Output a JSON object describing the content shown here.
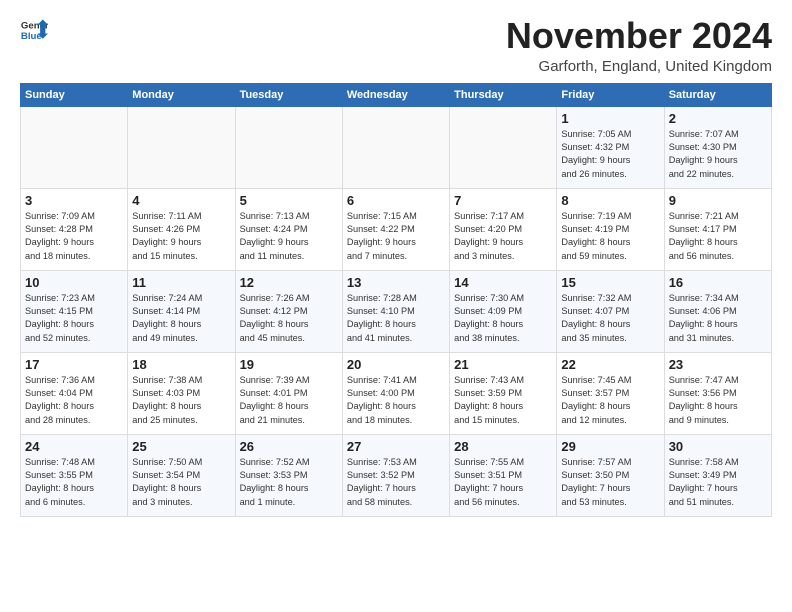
{
  "logo": {
    "general": "General",
    "blue": "Blue"
  },
  "title": "November 2024",
  "location": "Garforth, England, United Kingdom",
  "headers": [
    "Sunday",
    "Monday",
    "Tuesday",
    "Wednesday",
    "Thursday",
    "Friday",
    "Saturday"
  ],
  "weeks": [
    [
      {
        "day": "",
        "info": ""
      },
      {
        "day": "",
        "info": ""
      },
      {
        "day": "",
        "info": ""
      },
      {
        "day": "",
        "info": ""
      },
      {
        "day": "",
        "info": ""
      },
      {
        "day": "1",
        "info": "Sunrise: 7:05 AM\nSunset: 4:32 PM\nDaylight: 9 hours\nand 26 minutes."
      },
      {
        "day": "2",
        "info": "Sunrise: 7:07 AM\nSunset: 4:30 PM\nDaylight: 9 hours\nand 22 minutes."
      }
    ],
    [
      {
        "day": "3",
        "info": "Sunrise: 7:09 AM\nSunset: 4:28 PM\nDaylight: 9 hours\nand 18 minutes."
      },
      {
        "day": "4",
        "info": "Sunrise: 7:11 AM\nSunset: 4:26 PM\nDaylight: 9 hours\nand 15 minutes."
      },
      {
        "day": "5",
        "info": "Sunrise: 7:13 AM\nSunset: 4:24 PM\nDaylight: 9 hours\nand 11 minutes."
      },
      {
        "day": "6",
        "info": "Sunrise: 7:15 AM\nSunset: 4:22 PM\nDaylight: 9 hours\nand 7 minutes."
      },
      {
        "day": "7",
        "info": "Sunrise: 7:17 AM\nSunset: 4:20 PM\nDaylight: 9 hours\nand 3 minutes."
      },
      {
        "day": "8",
        "info": "Sunrise: 7:19 AM\nSunset: 4:19 PM\nDaylight: 8 hours\nand 59 minutes."
      },
      {
        "day": "9",
        "info": "Sunrise: 7:21 AM\nSunset: 4:17 PM\nDaylight: 8 hours\nand 56 minutes."
      }
    ],
    [
      {
        "day": "10",
        "info": "Sunrise: 7:23 AM\nSunset: 4:15 PM\nDaylight: 8 hours\nand 52 minutes."
      },
      {
        "day": "11",
        "info": "Sunrise: 7:24 AM\nSunset: 4:14 PM\nDaylight: 8 hours\nand 49 minutes."
      },
      {
        "day": "12",
        "info": "Sunrise: 7:26 AM\nSunset: 4:12 PM\nDaylight: 8 hours\nand 45 minutes."
      },
      {
        "day": "13",
        "info": "Sunrise: 7:28 AM\nSunset: 4:10 PM\nDaylight: 8 hours\nand 41 minutes."
      },
      {
        "day": "14",
        "info": "Sunrise: 7:30 AM\nSunset: 4:09 PM\nDaylight: 8 hours\nand 38 minutes."
      },
      {
        "day": "15",
        "info": "Sunrise: 7:32 AM\nSunset: 4:07 PM\nDaylight: 8 hours\nand 35 minutes."
      },
      {
        "day": "16",
        "info": "Sunrise: 7:34 AM\nSunset: 4:06 PM\nDaylight: 8 hours\nand 31 minutes."
      }
    ],
    [
      {
        "day": "17",
        "info": "Sunrise: 7:36 AM\nSunset: 4:04 PM\nDaylight: 8 hours\nand 28 minutes."
      },
      {
        "day": "18",
        "info": "Sunrise: 7:38 AM\nSunset: 4:03 PM\nDaylight: 8 hours\nand 25 minutes."
      },
      {
        "day": "19",
        "info": "Sunrise: 7:39 AM\nSunset: 4:01 PM\nDaylight: 8 hours\nand 21 minutes."
      },
      {
        "day": "20",
        "info": "Sunrise: 7:41 AM\nSunset: 4:00 PM\nDaylight: 8 hours\nand 18 minutes."
      },
      {
        "day": "21",
        "info": "Sunrise: 7:43 AM\nSunset: 3:59 PM\nDaylight: 8 hours\nand 15 minutes."
      },
      {
        "day": "22",
        "info": "Sunrise: 7:45 AM\nSunset: 3:57 PM\nDaylight: 8 hours\nand 12 minutes."
      },
      {
        "day": "23",
        "info": "Sunrise: 7:47 AM\nSunset: 3:56 PM\nDaylight: 8 hours\nand 9 minutes."
      }
    ],
    [
      {
        "day": "24",
        "info": "Sunrise: 7:48 AM\nSunset: 3:55 PM\nDaylight: 8 hours\nand 6 minutes."
      },
      {
        "day": "25",
        "info": "Sunrise: 7:50 AM\nSunset: 3:54 PM\nDaylight: 8 hours\nand 3 minutes."
      },
      {
        "day": "26",
        "info": "Sunrise: 7:52 AM\nSunset: 3:53 PM\nDaylight: 8 hours\nand 1 minute."
      },
      {
        "day": "27",
        "info": "Sunrise: 7:53 AM\nSunset: 3:52 PM\nDaylight: 7 hours\nand 58 minutes."
      },
      {
        "day": "28",
        "info": "Sunrise: 7:55 AM\nSunset: 3:51 PM\nDaylight: 7 hours\nand 56 minutes."
      },
      {
        "day": "29",
        "info": "Sunrise: 7:57 AM\nSunset: 3:50 PM\nDaylight: 7 hours\nand 53 minutes."
      },
      {
        "day": "30",
        "info": "Sunrise: 7:58 AM\nSunset: 3:49 PM\nDaylight: 7 hours\nand 51 minutes."
      }
    ]
  ]
}
